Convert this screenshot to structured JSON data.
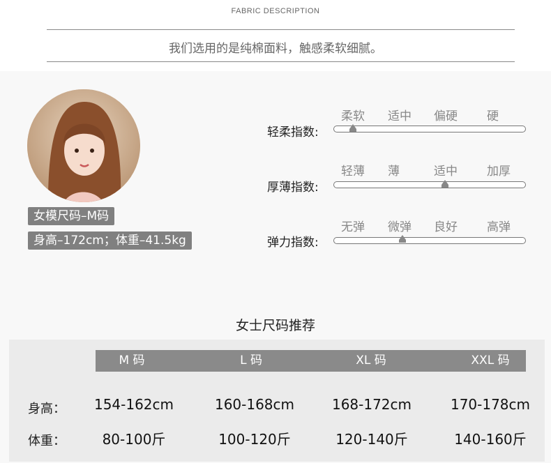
{
  "header": {
    "fabric_title": "FABRIC DESCRIPTION",
    "description": "我们选用的是纯棉面料，触感柔软细腻。"
  },
  "model": {
    "size_tag": "女模尺码–M码",
    "stats_tag": "身高–172cm；体重–41.5kg"
  },
  "indices": [
    {
      "label": "轻柔指数:",
      "options": [
        "柔软",
        "适中",
        "偏硬",
        "硬"
      ],
      "level": 0.1
    },
    {
      "label": "厚薄指数:",
      "options": [
        "轻薄",
        "薄",
        "适中",
        "加厚"
      ],
      "level": 0.58
    },
    {
      "label": "弹力指数:",
      "options": [
        "无弹",
        "微弹",
        "良好",
        "高弹"
      ],
      "level": 0.36
    }
  ],
  "size_table": {
    "title": "女士尺码推荐",
    "headers": [
      "M 码",
      "L 码",
      "XL 码",
      "XXL 码"
    ],
    "rows": [
      {
        "label": "身高：",
        "values": [
          "154-162cm",
          "160-168cm",
          "168-172cm",
          "170-178cm"
        ]
      },
      {
        "label": "体重：",
        "values": [
          "80-100斤",
          "100-120斤",
          "120-140斤",
          "140-160斤"
        ]
      }
    ]
  }
}
